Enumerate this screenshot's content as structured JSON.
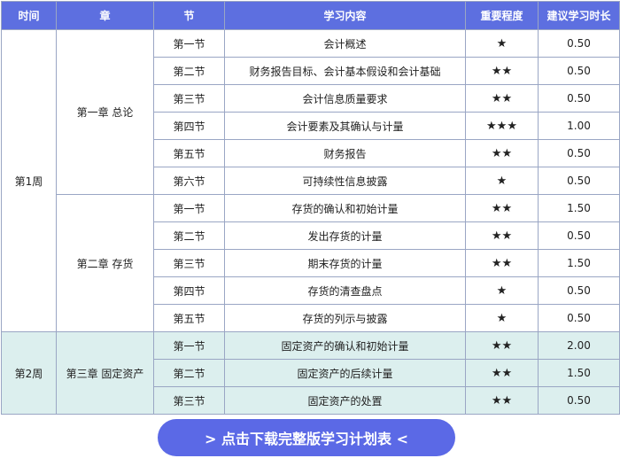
{
  "headers": {
    "week": "时间",
    "chapter": "章",
    "section": "节",
    "content": "学习内容",
    "importance": "重要程度",
    "hours": "建议学习时长"
  },
  "weeks": [
    {
      "label": "第1周",
      "chapters": [
        {
          "label": "第一章 总论",
          "rows": [
            {
              "section": "第一节",
              "content": "会计概述",
              "stars": "★",
              "hours": "0.50"
            },
            {
              "section": "第二节",
              "content": "财务报告目标、会计基本假设和会计基础",
              "stars": "★★",
              "hours": "0.50"
            },
            {
              "section": "第三节",
              "content": "会计信息质量要求",
              "stars": "★★",
              "hours": "0.50"
            },
            {
              "section": "第四节",
              "content": "会计要素及其确认与计量",
              "stars": "★★★",
              "hours": "1.00"
            },
            {
              "section": "第五节",
              "content": "财务报告",
              "stars": "★★",
              "hours": "0.50"
            },
            {
              "section": "第六节",
              "content": "可持续性信息披露",
              "stars": "★",
              "hours": "0.50"
            }
          ]
        },
        {
          "label": "第二章 存货",
          "rows": [
            {
              "section": "第一节",
              "content": "存货的确认和初始计量",
              "stars": "★★",
              "hours": "1.50"
            },
            {
              "section": "第二节",
              "content": "发出存货的计量",
              "stars": "★★",
              "hours": "0.50"
            },
            {
              "section": "第三节",
              "content": "期末存货的计量",
              "stars": "★★",
              "hours": "1.50"
            },
            {
              "section": "第四节",
              "content": "存货的清查盘点",
              "stars": "★",
              "hours": "0.50"
            },
            {
              "section": "第五节",
              "content": "存货的列示与披露",
              "stars": "★",
              "hours": "0.50"
            }
          ]
        }
      ]
    },
    {
      "label": "第2周",
      "chapters": [
        {
          "label": "第三章 固定资产",
          "rows": [
            {
              "section": "第一节",
              "content": "固定资产的确认和初始计量",
              "stars": "★★",
              "hours": "2.00"
            },
            {
              "section": "第二节",
              "content": "固定资产的后续计量",
              "stars": "★★",
              "hours": "1.50"
            },
            {
              "section": "第三节",
              "content": "固定资产的处置",
              "stars": "★★",
              "hours": "0.50"
            }
          ]
        }
      ]
    }
  ],
  "download_button": "> 点击下载完整版学习计划表 <"
}
